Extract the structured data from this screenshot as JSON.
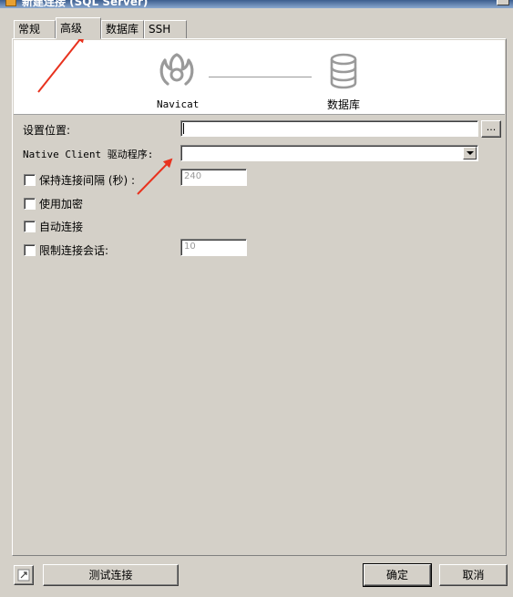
{
  "window": {
    "title": "新建连接 (SQL Server)"
  },
  "tabs": [
    "常规",
    "高级",
    "数据库",
    "SSH"
  ],
  "header": {
    "left_label": "Navicat",
    "right_label": "数据库"
  },
  "form": {
    "settings_location_label": "设置位置:",
    "settings_location_value": "",
    "browse_button": "...",
    "native_client_label": "Native Client 驱动程序:",
    "native_client_value": "",
    "keepalive_label": "保持连接间隔 (秒) :",
    "keepalive_value": "240",
    "encrypt_label": "使用加密",
    "autoconnect_label": "自动连接",
    "limit_sessions_label": "限制连接会话:",
    "limit_sessions_value": "10"
  },
  "footer": {
    "test_button": "测试连接",
    "ok_button": "确定",
    "cancel_button": "取消"
  },
  "colors": {
    "annotation": "#e8321e",
    "window_bg": "#d4d0c8"
  }
}
